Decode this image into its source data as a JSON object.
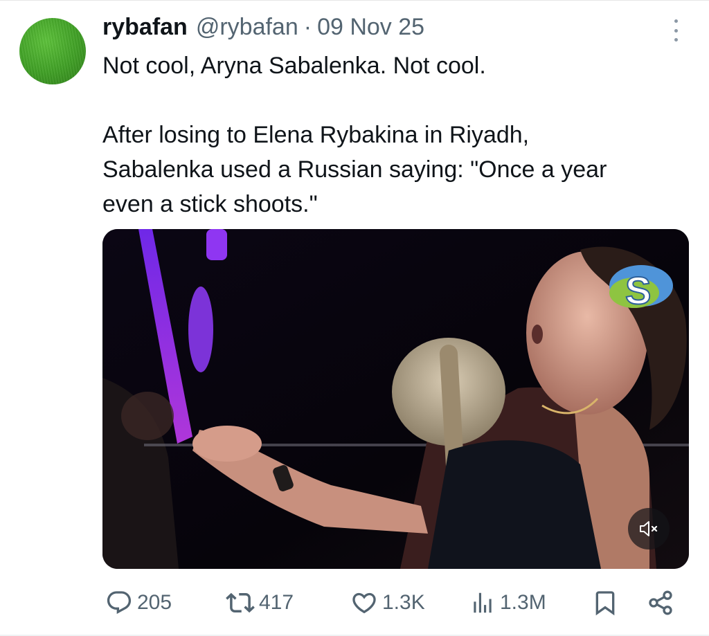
{
  "tweet": {
    "display_name": "rybafan",
    "handle": "@rybafan",
    "separator": "·",
    "date": "09 Nov 25",
    "text_line1": "Not cool, Aryna Sabalenka. Not cool.",
    "text_line2": "After losing to Elena Rybakina in Riyadh,",
    "text_line3": "Sabalenka used a Russian saying: \"Once a year",
    "text_line4": "even a stick shoots.\""
  },
  "media": {
    "type": "video",
    "muted": true,
    "overlay_logo": "s-channel-logo"
  },
  "actions": {
    "replies": "205",
    "reposts": "417",
    "likes": "1.3K",
    "views": "1.3M"
  },
  "icons": {
    "reply": "reply-icon",
    "repost": "repost-icon",
    "like": "heart-icon",
    "views": "views-icon",
    "bookmark": "bookmark-icon",
    "share": "share-icon",
    "more": "more-options-icon",
    "mute": "volume-muted-icon"
  },
  "colors": {
    "text": "#0f1419",
    "secondary": "#536471"
  }
}
